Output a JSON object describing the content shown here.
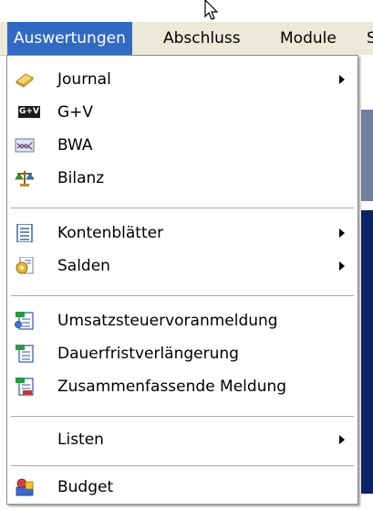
{
  "menubar": {
    "items": [
      {
        "label": "Auswertungen",
        "active": true
      },
      {
        "label": "Abschluss"
      },
      {
        "label": "Module"
      },
      {
        "label": "S"
      }
    ]
  },
  "dropdown": {
    "items": [
      {
        "label": "Journal",
        "icon": "journal-icon",
        "submenu": true
      },
      {
        "label": "G+V",
        "icon": "gv-icon",
        "icon_text": "G+V",
        "submenu": false
      },
      {
        "label": "BWA",
        "icon": "bwa-chart-icon",
        "submenu": false
      },
      {
        "label": "Bilanz",
        "icon": "scales-icon",
        "submenu": false
      },
      {
        "label": "Kontenblätter",
        "icon": "document-list-icon",
        "submenu": true
      },
      {
        "label": "Salden",
        "icon": "gear-document-icon",
        "submenu": true
      },
      {
        "label": "Umsatzsteuervoranmeldung",
        "icon": "tax-form-icon",
        "submenu": false
      },
      {
        "label": "Dauerfristverlängerung",
        "icon": "extension-form-icon",
        "submenu": false
      },
      {
        "label": "Zusammenfassende Meldung",
        "icon": "summary-form-icon",
        "submenu": false
      },
      {
        "label": "Listen",
        "icon": "",
        "submenu": true
      },
      {
        "label": "Budget",
        "icon": "budget-icon",
        "submenu": false
      }
    ]
  },
  "colors": {
    "menu_highlight": "#316ac5",
    "menubar_bg": "#ece9d8",
    "window_dark": "#0a246a"
  }
}
